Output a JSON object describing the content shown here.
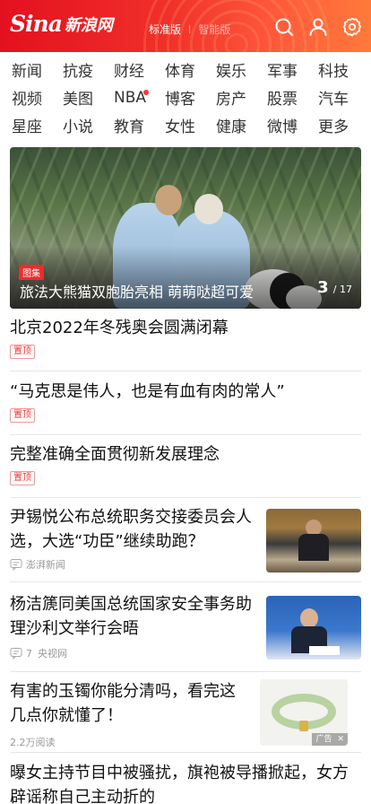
{
  "header": {
    "logo_en": "Sina",
    "logo_cn": "新浪网",
    "version_standard": "标准版",
    "version_sep": "|",
    "version_smart": "智能版",
    "icons": [
      "search-icon",
      "user-icon",
      "settings-icon"
    ]
  },
  "nav": {
    "rows": [
      [
        "新闻",
        "抗疫",
        "财经",
        "体育",
        "娱乐",
        "军事",
        "科技"
      ],
      [
        "视频",
        "美图",
        "NBA",
        "博客",
        "房产",
        "股票",
        "汽车"
      ],
      [
        "星座",
        "小说",
        "教育",
        "女性",
        "健康",
        "微博",
        "更多"
      ]
    ]
  },
  "banner": {
    "tag": "图集",
    "title": "旅法大熊猫双胞胎亮相 萌萌哒超可爱",
    "current": "3",
    "total": "/ 17"
  },
  "feed": [
    {
      "title": "北京2022年冬残奥会圆满闭幕",
      "badge": "置顶"
    },
    {
      "title": "“马克思是伟人，也是有血有肉的常人”",
      "badge": "置顶"
    },
    {
      "title": "完整准确全面贯彻新发展理念",
      "badge": "置顶"
    },
    {
      "title": "尹锡悦公布总统职务交接委员会人选，大选“功臣”继续助跑？",
      "source": "澎湃新闻"
    },
    {
      "title": "杨洁篪同美国总统国家安全事务助理沙利文举行会晤",
      "comments": "7",
      "source": "央视网"
    },
    {
      "title": "有害的玉镯你能分清吗，看完这几点你就懂了！",
      "reads": "2.2万阅读",
      "ad_label": "广告"
    },
    {
      "title": "曝女主持节目中被骚扰，旗袍被导播掀起，女方辟谣称自己主动折的"
    }
  ],
  "colors": {
    "brand_red": "#e4101f",
    "badge_red": "#e33333"
  }
}
